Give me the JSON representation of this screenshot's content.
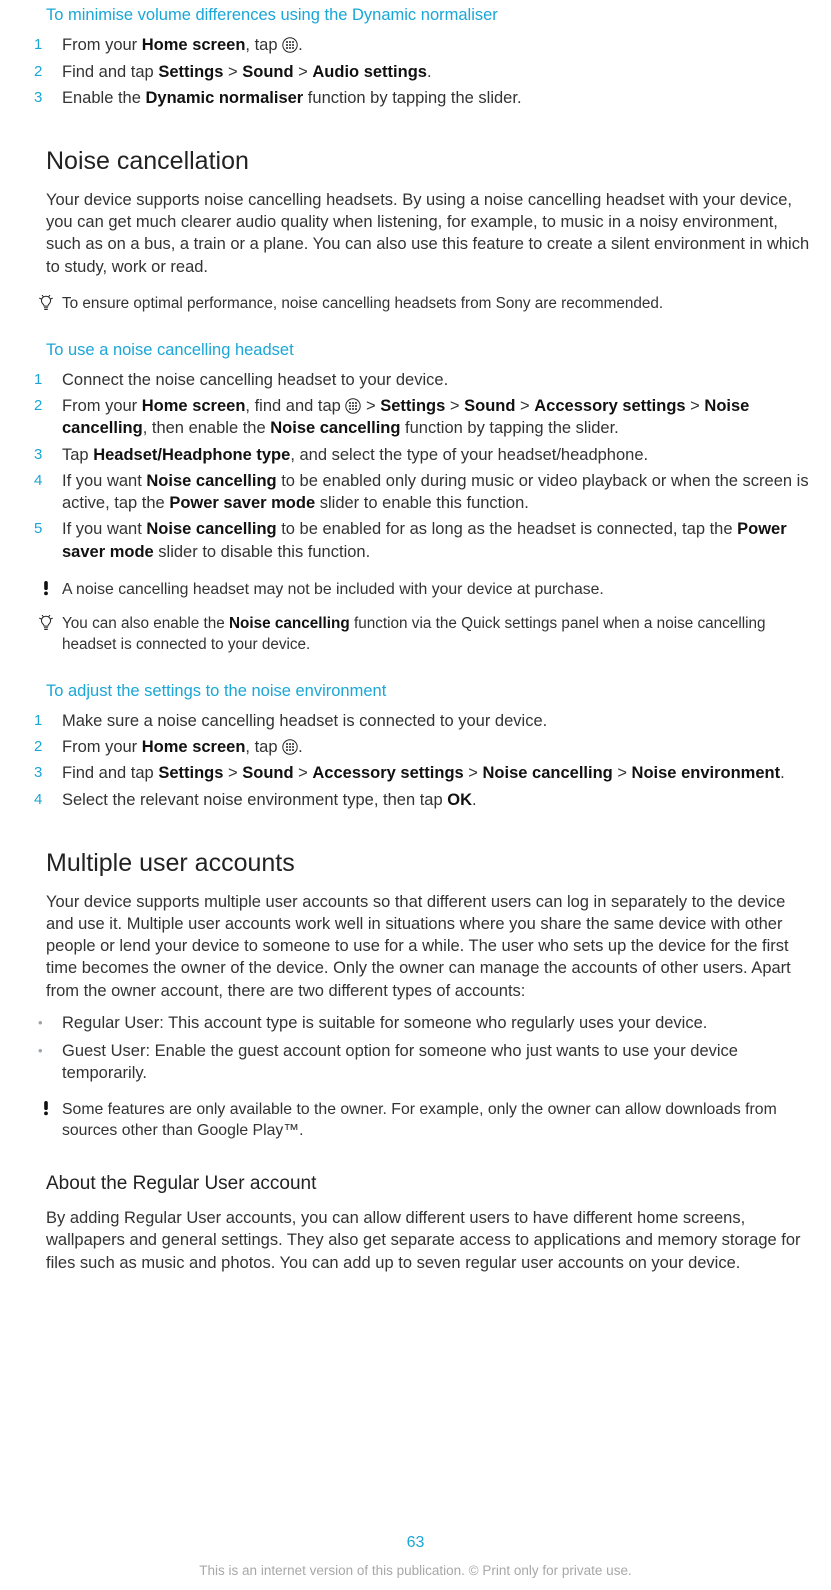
{
  "h_minimise": "To minimise volume differences using the Dynamic normaliser",
  "steps_min": {
    "s1a": "From your ",
    "s1b": "Home screen",
    "s1c": ", tap ",
    "s1d": ".",
    "s2a": "Find and tap ",
    "s2b": "Settings",
    "s2c": " > ",
    "s2d": "Sound",
    "s2e": " > ",
    "s2f": "Audio settings",
    "s2g": ".",
    "s3a": "Enable the ",
    "s3b": "Dynamic normaliser",
    "s3c": " function by tapping the slider."
  },
  "h_noise": "Noise cancellation",
  "p_noise": "Your device supports noise cancelling headsets. By using a noise cancelling headset with your device, you can get much clearer audio quality when listening, for example, to music in a noisy environment, such as on a bus, a train or a plane. You can also use this feature to create a silent environment in which to study, work or read.",
  "tip_noise": "To ensure optimal performance, noise cancelling headsets from Sony are recommended.",
  "h_use_nc": "To use a noise cancelling headset",
  "steps_nc": {
    "s1": "Connect the noise cancelling headset to your device.",
    "s2a": "From your ",
    "s2b": "Home screen",
    "s2c": ", find and tap ",
    "s2d": " > ",
    "s2e": "Settings",
    "s2f": " > ",
    "s2g": "Sound",
    "s2h": " > ",
    "s2i": "Accessory settings",
    "s2j": " > ",
    "s2k": "Noise cancelling",
    "s2l": ", then enable the ",
    "s2m": "Noise cancelling",
    "s2n": " function by tapping the slider.",
    "s3a": "Tap ",
    "s3b": "Headset/Headphone type",
    "s3c": ", and select the type of your headset/headphone.",
    "s4a": "If you want ",
    "s4b": "Noise cancelling",
    "s4c": " to be enabled only during music or video playback or when the screen is active, tap the ",
    "s4d": "Power saver mode",
    "s4e": " slider to enable this function.",
    "s5a": "If you want ",
    "s5b": "Noise cancelling",
    "s5c": " to be enabled for as long as the headset is connected, tap the ",
    "s5d": "Power saver mode",
    "s5e": " slider to disable this function."
  },
  "warn_nc": "A noise cancelling headset may not be included with your device at purchase.",
  "tip_nc2a": "You can also enable the ",
  "tip_nc2b": "Noise cancelling",
  "tip_nc2c": " function via the Quick settings panel when a noise cancelling headset is connected to your device.",
  "h_adjust": "To adjust the settings to the noise environment",
  "steps_adj": {
    "s1": "Make sure a noise cancelling headset is connected to your device.",
    "s2a": "From your ",
    "s2b": "Home screen",
    "s2c": ", tap ",
    "s2d": ".",
    "s3a": "Find and tap ",
    "s3b": "Settings",
    "s3c": " > ",
    "s3d": "Sound",
    "s3e": " > ",
    "s3f": "Accessory settings",
    "s3g": " > ",
    "s3h": "Noise cancelling",
    "s3i": " > ",
    "s3j": "Noise environment",
    "s3k": ".",
    "s4a": "Select the relevant noise environment type, then tap ",
    "s4b": "OK",
    "s4c": "."
  },
  "h_multi": "Multiple user accounts",
  "p_multi": "Your device supports multiple user accounts so that different users can log in separately to the device and use it. Multiple user accounts work well in situations where you share the same device with other people or lend your device to someone to use for a while. The user who sets up the device for the first time becomes the owner of the device. Only the owner can manage the accounts of other users. Apart from the owner account, there are two different types of accounts:",
  "bul1": "Regular User: This account type is suitable for someone who regularly uses your device.",
  "bul2": "Guest User: Enable the guest account option for someone who just wants to use your device temporarily.",
  "warn_multi": "Some features are only available to the owner. For example, only the owner can allow downloads from sources other than Google Play™.",
  "h_reg": "About the Regular User account",
  "p_reg": "By adding Regular User accounts, you can allow different users to have different home screens, wallpapers and general settings. They also get separate access to applications and memory storage for files such as music and photos. You can add up to seven regular user accounts on your device.",
  "page_number": "63",
  "footer": "This is an internet version of this publication. © Print only for private use."
}
